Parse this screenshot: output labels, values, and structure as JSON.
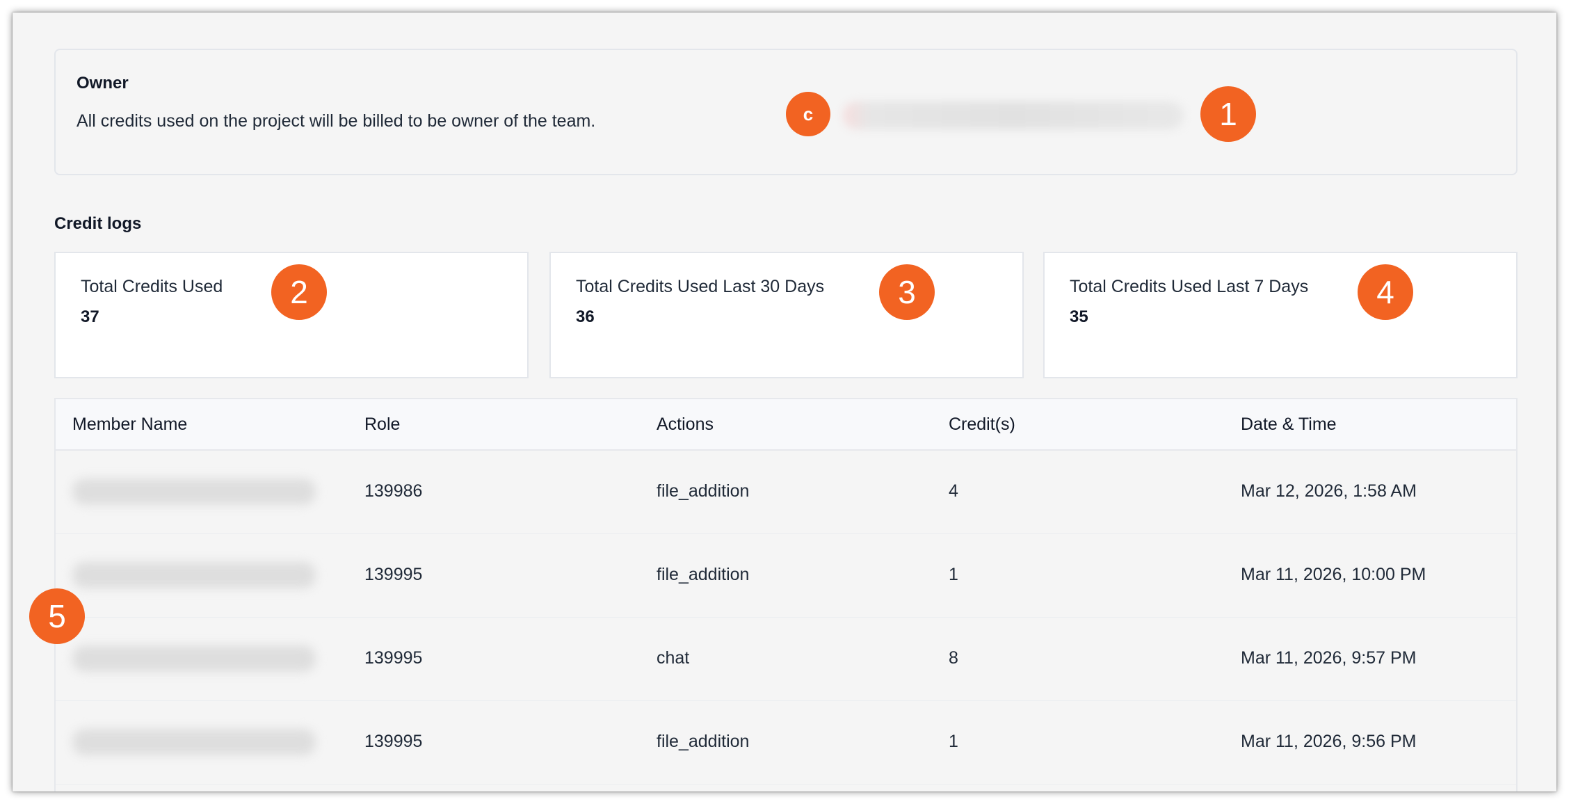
{
  "owner": {
    "title": "Owner",
    "description": "All credits used on the project will be billed to be owner of the team.",
    "avatar_letter": "c"
  },
  "callouts": [
    "1",
    "2",
    "3",
    "4",
    "5"
  ],
  "credit_logs": {
    "title": "Credit logs",
    "stats": [
      {
        "label": "Total Credits Used",
        "value": "37"
      },
      {
        "label": "Total Credits Used Last 30 Days",
        "value": "36"
      },
      {
        "label": "Total Credits Used Last 7 Days",
        "value": "35"
      }
    ]
  },
  "table": {
    "columns": [
      "Member Name",
      "Role",
      "Actions",
      "Credit(s)",
      "Date & Time"
    ],
    "rows": [
      {
        "role": "139986",
        "action": "file_addition",
        "credits": "4",
        "datetime": "Mar 12, 2026, 1:58 AM"
      },
      {
        "role": "139995",
        "action": "file_addition",
        "credits": "1",
        "datetime": "Mar 11, 2026, 10:00 PM"
      },
      {
        "role": "139995",
        "action": "chat",
        "credits": "8",
        "datetime": "Mar 11, 2026, 9:57 PM"
      },
      {
        "role": "139995",
        "action": "file_addition",
        "credits": "1",
        "datetime": "Mar 11, 2026, 9:56 PM"
      }
    ]
  },
  "colors": {
    "accent": "#f26322",
    "page_bg": "#f5f5f5",
    "card_bg": "#ffffff",
    "border": "#e3e6eb"
  }
}
